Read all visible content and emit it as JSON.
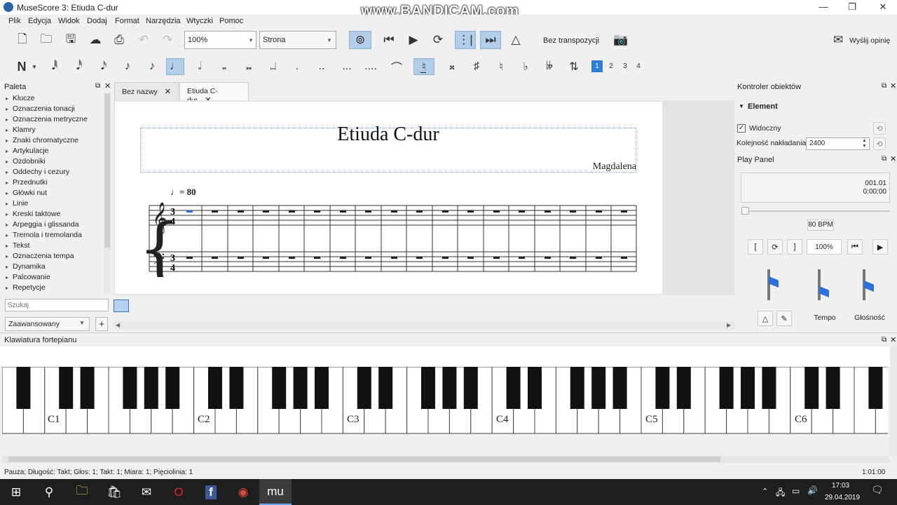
{
  "window": {
    "title": "MuseScore 3: Etiuda C-dur",
    "watermark": "www.BANDICAM.com",
    "minimize": "—",
    "maximize": "❐",
    "close": "✕"
  },
  "menu": [
    "Plik",
    "Edycja",
    "Widok",
    "Dodaj",
    "Format",
    "Narzędzia",
    "Wtyczki",
    "Pomoc"
  ],
  "toolbar": {
    "zoom": "100%",
    "view_mode": "Strona",
    "transpose": "Bez transpozycji",
    "feedback": "Wyślij opinię"
  },
  "note_toolbar": {
    "voices": [
      "1",
      "2",
      "3",
      "4"
    ]
  },
  "palette": {
    "title": "Paleta",
    "items": [
      "Klucze",
      "Oznaczenia tonacji",
      "Oznaczenia metryczne",
      "Klamry",
      "Znaki chromatyczne",
      "Artykulacje",
      "Ozdobniki",
      "Oddechy i cezury",
      "Przednutki",
      "Główki nut",
      "Linie",
      "Kreski taktowe",
      "Arpeggia i glissanda",
      "Tremola i tremolanda",
      "Tekst",
      "Oznaczenia tempa",
      "Dynamika",
      "Palcowanie",
      "Repetycje"
    ],
    "search_placeholder": "Szukaj",
    "mode": "Zaawansowany",
    "add": "+"
  },
  "tabs": [
    {
      "label": "Bez nazwy",
      "close": "✕"
    },
    {
      "label": "Etiuda C-dur",
      "close": "✕"
    }
  ],
  "score": {
    "title": "Etiuda C-dur",
    "composer": "Magdalena",
    "tempo": "♩= 80"
  },
  "inspector": {
    "title": "Kontroler obiektów",
    "section": "Element",
    "visible_label": "Widoczny",
    "order_label": "Kolejność nakładania:",
    "order_value": "2400"
  },
  "play_panel": {
    "title": "Play Panel",
    "position": "001.01",
    "time": "0:00:00",
    "bpm": "80 BPM",
    "zoom": "100%",
    "tempo_label": "Tempo",
    "volume_label": "Głośność"
  },
  "piano": {
    "title": "Klawiatura fortepianu",
    "labels": [
      "C1",
      "C2",
      "C3",
      "C4",
      "C5",
      "C6"
    ]
  },
  "status": {
    "text": "Pauza; Długość: Takt; Głos: 1;  Takt: 1; Miara: 1; Pięciolinia: 1",
    "time": "1:01:00"
  },
  "taskbar": {
    "time": "17:03",
    "date": "29.04.2019"
  },
  "colors": {
    "accent": "#2d7ddb",
    "selected": "#b4cde8"
  }
}
